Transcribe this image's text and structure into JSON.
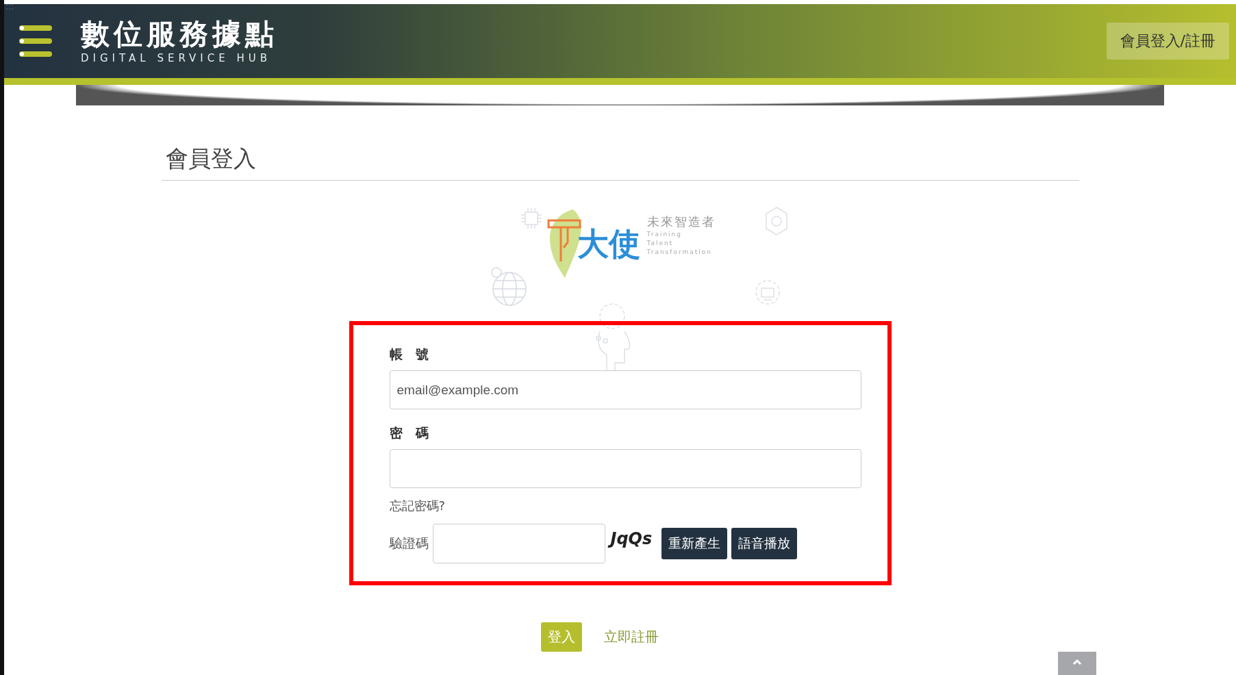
{
  "header": {
    "title": "數位服務據點",
    "subtitle": "DIGITAL SERVICE HUB",
    "login_register_button": "會員登入/註冊"
  },
  "page_title": "會員登入",
  "logo": {
    "name": "大使",
    "slogan": "未來智造者",
    "tagline": [
      "Training",
      "Talent",
      "Transformation"
    ]
  },
  "form": {
    "account": {
      "label": "帳　號",
      "placeholder": "email@example.com"
    },
    "password": {
      "label": "密　碼"
    },
    "forgot_link": "忘記密碼?",
    "captcha": {
      "label": "驗證碼",
      "code": "JqQs",
      "buttons": [
        "重新產生",
        "語音播放"
      ]
    }
  },
  "actions": {
    "login": "登入",
    "register": "立即註冊"
  }
}
